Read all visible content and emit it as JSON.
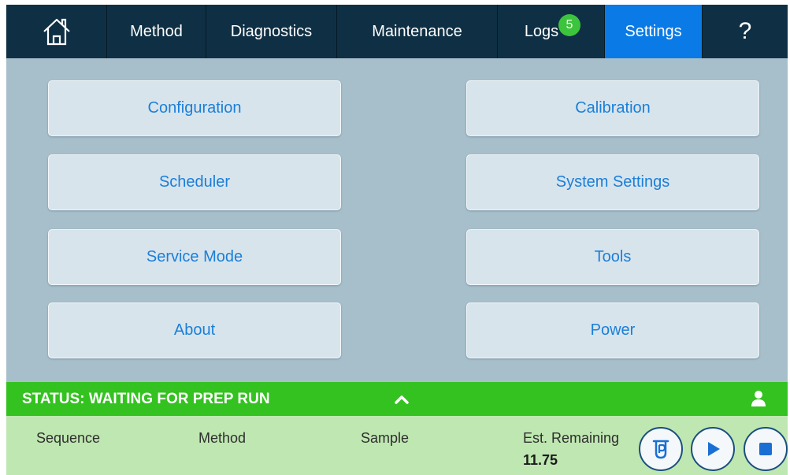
{
  "nav": {
    "home_icon": "home-icon",
    "items": [
      {
        "label": "Method"
      },
      {
        "label": "Diagnostics"
      },
      {
        "label": "Maintenance"
      },
      {
        "label": "Logs",
        "badge": "5"
      },
      {
        "label": "Settings",
        "active": true
      }
    ],
    "help_label": "?"
  },
  "tiles": {
    "configuration": "Configuration",
    "calibration": "Calibration",
    "scheduler": "Scheduler",
    "system_settings": "System Settings",
    "service_mode": "Service Mode",
    "tools": "Tools",
    "about": "About",
    "power": "Power"
  },
  "status": {
    "text": "STATUS: WAITING FOR PREP RUN",
    "chevron_icon": "chevron-up-icon",
    "user_icon": "user-icon"
  },
  "info": {
    "sequence_label": "Sequence",
    "method_label": "Method",
    "sample_label": "Sample",
    "est_label": "Est. Remaining",
    "est_value": "11.75"
  },
  "controls": {
    "prep_icon": "prep-tube-icon",
    "play_icon": "play-icon",
    "stop_icon": "stop-icon"
  },
  "colors": {
    "nav_bg": "#0f3044",
    "nav_active": "#0a7ae6",
    "content_bg": "#a7bfcb",
    "tile_bg": "#d8e4ec",
    "tile_text": "#1a7fd8",
    "status_bg": "#33c21f",
    "info_bg": "#bfe7b1",
    "badge": "#3cc43c",
    "control_accent": "#1a6fd4"
  }
}
